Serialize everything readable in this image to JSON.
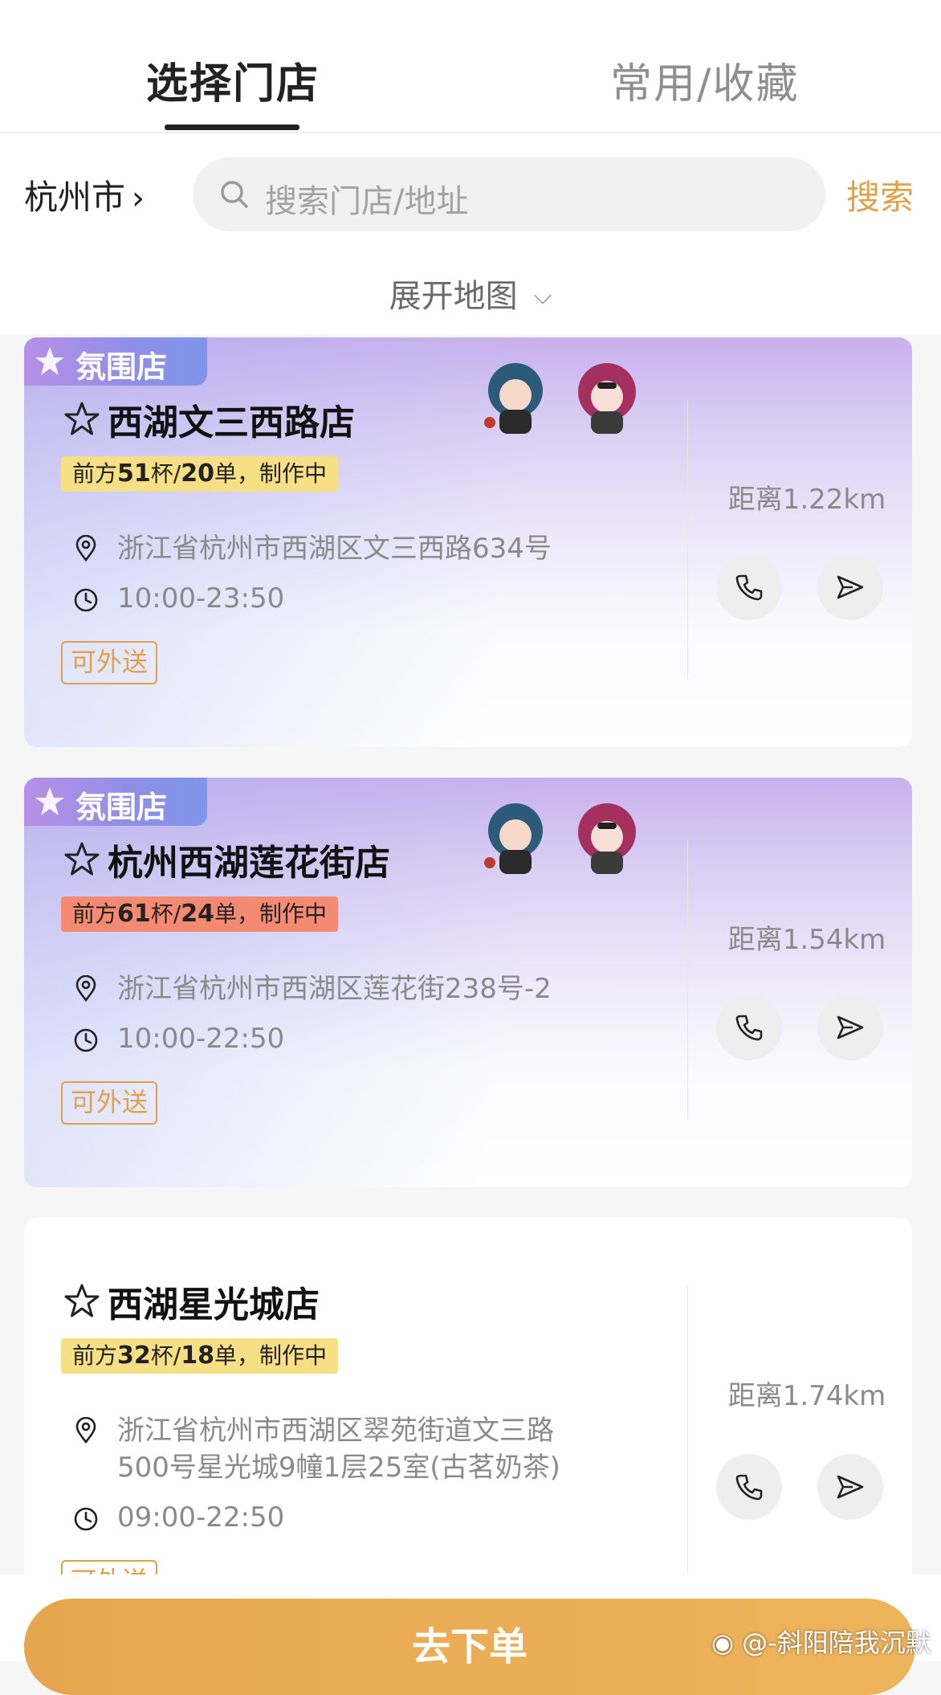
{
  "tabs": [
    {
      "label": "选择门店",
      "active": true
    },
    {
      "label": "常用/收藏",
      "active": false
    }
  ],
  "search": {
    "city": "杭州市",
    "placeholder": "搜索门店/地址",
    "button": "搜索",
    "expand_map": "展开地图"
  },
  "stores": [
    {
      "badge": "氛围店",
      "name": "西湖文三西路店",
      "queue_prefix": "前方",
      "cups": "51",
      "cups_unit": "杯/",
      "orders": "20",
      "queue_suffix": "单，制作中",
      "address": "浙江省杭州市西湖区文三西路634号",
      "hours": "10:00-23:50",
      "delivery": "可外送",
      "distance": "距离1.22km"
    },
    {
      "badge": "氛围店",
      "name": "杭州西湖莲花街店",
      "queue_prefix": "前方",
      "cups": "61",
      "cups_unit": "杯/",
      "orders": "24",
      "queue_suffix": "单，制作中",
      "address": "浙江省杭州市西湖区莲花街238号-2",
      "hours": "10:00-22:50",
      "delivery": "可外送",
      "distance": "距离1.54km"
    },
    {
      "name": "西湖星光城店",
      "queue_prefix": "前方",
      "cups": "32",
      "cups_unit": "杯/",
      "orders": "18",
      "queue_suffix": "单，制作中",
      "address_line1": "浙江省杭州市西湖区翠苑街道文三路",
      "address_line2": "500号星光城9幢1层25室(古茗奶茶)",
      "hours": "09:00-22:50",
      "delivery": "可外送",
      "distance": "距离1.74km"
    }
  ],
  "order_button": "去下单",
  "watermark": "@-斜阳陪我沉默",
  "colors": {
    "accent": "#e3a04a",
    "queue_yellow": "#f7df85",
    "queue_red": "#f58a72",
    "badge_purple": "#9b8ee8"
  },
  "icons": [
    "search-icon",
    "chevron-right-icon",
    "chevron-down-icon",
    "star-icon",
    "location-pin-icon",
    "clock-icon",
    "phone-icon",
    "navigate-icon",
    "weibo-icon"
  ]
}
